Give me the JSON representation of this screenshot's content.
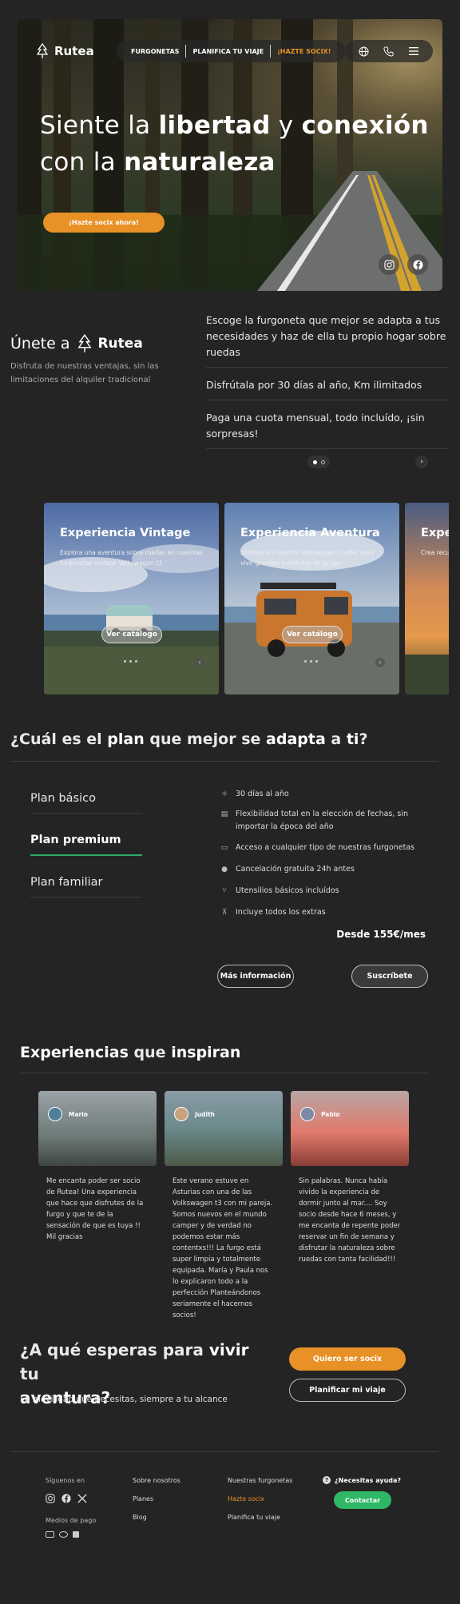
{
  "header": {
    "brand": "Rutea",
    "nav": [
      {
        "label": "FURGONETAS"
      },
      {
        "label": "PLANIFICA TU VIAJE"
      },
      {
        "label": "¡HAZTE SOCIX!"
      }
    ],
    "icons": [
      "globe-icon",
      "phone-icon",
      "menu-icon"
    ]
  },
  "hero": {
    "title_1": "Siente la ",
    "title_bold_1": "libertad",
    "title_2": " y ",
    "title_bold_2": "conexión",
    "title_3": "con la ",
    "title_bold_3": "naturaleza",
    "cta": "¡Hazte socix ahora!",
    "social": [
      "instagram-icon",
      "facebook-icon"
    ]
  },
  "join": {
    "title": "Únete a",
    "brand": "Rutea",
    "subtitle": "Disfruta de nuestras ventajas, sin las limitaciones del alquiler tradicional",
    "benefits": [
      "Escoge la furgoneta que mejor se adapta a tus necesidades y haz de ella tu propio hogar sobre ruedas",
      "Disfrútala por 30 días al año, Km ilimitados",
      "Paga una cuota mensual, todo incluído, ¡sin sorpresas!"
    ]
  },
  "experiences_carousel": [
    {
      "title": "Experiencia Vintage",
      "text": "Explora una aventura sobre ruedas en nuestras furgonetas vintage Volkswagen t3",
      "button": "Ver catálogo"
    },
    {
      "title": "Experiencia Aventura",
      "text": "Disfruta en nuestra Volkswagen Crafter para vivir grandes aventuras en grupo",
      "button": "Ver catálogo"
    },
    {
      "title": "Expe",
      "text": "Crea recu queridos a",
      "button": ""
    }
  ],
  "plans": {
    "title_1": "¿Cuál es el ",
    "title_b1": "plan",
    "title_2": " que mejor se ",
    "title_b2": "adapta",
    "title_3": " a ",
    "title_b3": "ti",
    "title_4": "?",
    "tabs": [
      "Plan básico",
      "Plan premium",
      "Plan familiar"
    ],
    "features": [
      {
        "icon": "sun-icon",
        "text": "30 días al año"
      },
      {
        "icon": "calendar-icon",
        "text": "Flexibilidad total en la elección de fechas, sin importar la época del año"
      },
      {
        "icon": "van-icon",
        "text": "Acceso a cualquier tipo de nuestras furgonetas"
      },
      {
        "icon": "check-circle-icon",
        "text": "Cancelación gratuita 24h antes"
      },
      {
        "icon": "utensils-icon",
        "text": "Utensilios básicos incluídos"
      },
      {
        "icon": "extras-icon",
        "text": "Incluye todos los extras"
      }
    ],
    "price": "Desde 155€/mes",
    "more_info": "Más información",
    "subscribe": "Suscríbete"
  },
  "testimonials": {
    "title_b1": "Experiencias",
    "title_2": " que ",
    "title_b2": "inspiran",
    "items": [
      {
        "name": "Mario",
        "text": "Me encanta poder ser socio de Rutea! Una experiencia que hace que disfrutes de la furgo y que te de la sensación de que es tuya !! Mil gracias"
      },
      {
        "name": "Judith",
        "text": "Este verano estuve en Asturias con una de las Volkswagen t3 con mi pareja. Somos nuevos en el mundo camper y de verdad no podemos estar más contentxs!!! La furgo está super limpia y totalmente equipada. María y Paula nos lo explicaron todo a la perfección Planteándonos seriamente el hacernos socios!"
      },
      {
        "name": "Pablo",
        "text": "Sin palabras. Nunca había vivido la experiencia de dormir junto al mar.... Soy socio desde hace 6 meses, y me encanta de repente poder reservar un fin de semana y disfrutar la naturaleza sobre ruedas con tanta facilidad!!!"
      }
    ]
  },
  "cta": {
    "t1": "¿A qué esperas para ",
    "tb1": "vivir",
    "t2": " tu",
    "tb2": "aventura?",
    "subtitle": "La movilidad que necesitas, siempre a tu alcance",
    "primary": "Quiero ser socix",
    "secondary": "Planificar mi viaje"
  },
  "footer": {
    "follow": "Síguenos en",
    "payment": "Medios de pago",
    "col1": [
      "Sobre nosotros",
      "Planes",
      "Blog"
    ],
    "col2": [
      "Nuestras furgonetas",
      "Hazte socix",
      "Planifica tu viaje"
    ],
    "help": "¿Necesitas ayuda?",
    "contact": "Contactar"
  },
  "colors": {
    "accent": "#e89127",
    "green": "#2fb765",
    "bg": "#242424"
  }
}
